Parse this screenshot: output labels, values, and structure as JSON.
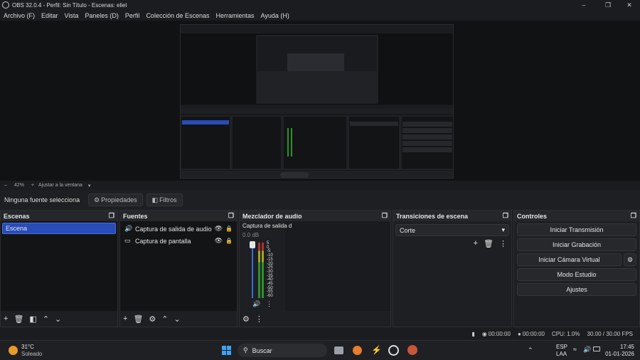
{
  "window": {
    "title": "OBS 32.0.4 - Perfil: Sin Título - Escenas: eliel"
  },
  "menu": [
    "Archivo (F)",
    "Editar",
    "Vista",
    "Paneles (D)",
    "Perfil",
    "Colección de Escenas",
    "Herramientas",
    "Ayuda (H)"
  ],
  "zoom": {
    "value": "42%",
    "fit_label": "Ajustar a la ventana"
  },
  "sourcebar": {
    "no_source": "Ninguna fuente selecciona",
    "properties": "Propiedades",
    "filters": "Filtros"
  },
  "scenes": {
    "title": "Escenas",
    "items": [
      "Escena"
    ]
  },
  "sources": {
    "title": "Fuentes",
    "items": [
      "Captura de salida de audio",
      "Captura de pantalla"
    ]
  },
  "mixer": {
    "title": "Mezclador de audio",
    "channel_name": "Captura de salida d",
    "db": "0.0 dB",
    "scale": [
      "5",
      "0",
      "-5",
      "-10",
      "-15",
      "-20",
      "-25",
      "-30",
      "-35",
      "-40",
      "-45",
      "-50",
      "-55",
      "-60"
    ]
  },
  "transitions": {
    "title": "Transiciones de escena",
    "selected": "Corte"
  },
  "controls": {
    "title": "Controles",
    "start_stream": "Iniciar Transmisión",
    "start_record": "Iniciar Grabación",
    "virtual_cam": "Iniciar Cámara Virtual",
    "studio_mode": "Modo Estudio",
    "settings": "Ajustes"
  },
  "status": {
    "stream_time": "00:00:00",
    "record_time": "00:00:00",
    "cpu": "CPU: 1.0%",
    "fps": "30.00 / 30.00 FPS"
  },
  "taskbar": {
    "weather_temp": "31°C",
    "weather_desc": "Soleado",
    "search": "Buscar",
    "lang_top": "ESP",
    "lang_bottom": "LAA",
    "time": "17:45",
    "date": "01-01-2026"
  },
  "colors": {
    "accent": "#284cb8",
    "background": "#1e1f22",
    "meter_green": "#2f8f2f",
    "meter_yellow": "#a3a32a",
    "meter_red": "#a83232"
  }
}
